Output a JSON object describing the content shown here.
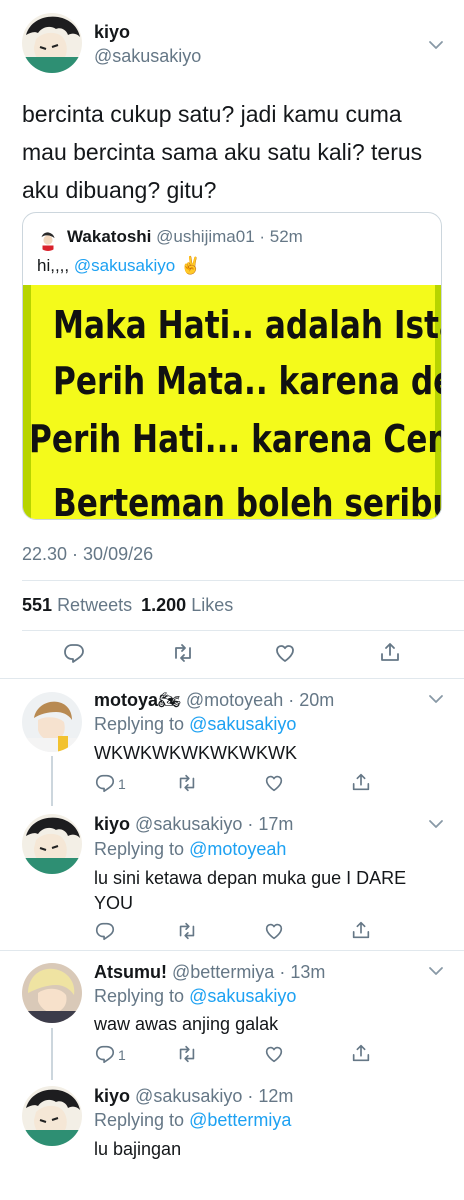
{
  "main_tweet": {
    "name": "kiyo",
    "handle": "@sakusakiyo",
    "text_line1": "bercinta cukup satu? jadi kamu cuma",
    "text_line2": "mau bercinta sama aku satu kali? terus",
    "text_line3": "aku dibuang? gitu?",
    "quote": {
      "name": "Wakatoshi",
      "handle_time": "@ushijima01 · 52m",
      "text_prefix": "hi,,,,",
      "mention": "@sakusakiyo",
      "emoji": "✌",
      "image_lines": [
        "Maka Hati.. adalah Istana,",
        "Perih Mata.. karena debu,",
        "Perih Hati... karena Cemburu,",
        "Berteman boleh seribu .. !!"
      ]
    },
    "timestamp": "22.30 · 30/09/26",
    "retweets_count": "551",
    "retweets_label": "Retweets",
    "likes_count": "1.200",
    "likes_label": "Likes"
  },
  "replies": [
    {
      "name": "motoya",
      "name_emoji": "🏍",
      "handle_time": "@motoyeah · 20m",
      "replying_label": "Replying to",
      "replying_to": "@sakusakiyo",
      "text": "WKWKWKWKWKWKWK",
      "reply_count": "1"
    },
    {
      "name": "kiyo",
      "handle_time": "@sakusakiyo · 17m",
      "replying_label": "Replying to",
      "replying_to": "@motoyeah",
      "text_line1": "lu sini ketawa depan muka gue I DARE",
      "text_line2": "YOU"
    },
    {
      "name": "Atsumu!",
      "handle_time": "@bettermiya · 13m",
      "replying_label": "Replying to",
      "replying_to": "@sakusakiyo",
      "text": "waw awas anjing galak",
      "reply_count": "1"
    },
    {
      "name": "kiyo",
      "handle_time": "@sakusakiyo · 12m",
      "replying_label": "Replying to",
      "replying_to": "@bettermiya",
      "text": "lu bajingan"
    }
  ],
  "colors": {
    "accent": "#1da1f2",
    "secondary_text": "#657786",
    "divider": "#e1e8ed",
    "meme_background": "#f4fa1b"
  },
  "icons": [
    "reply-icon",
    "retweet-icon",
    "like-icon",
    "share-icon",
    "chevron-down-icon"
  ]
}
